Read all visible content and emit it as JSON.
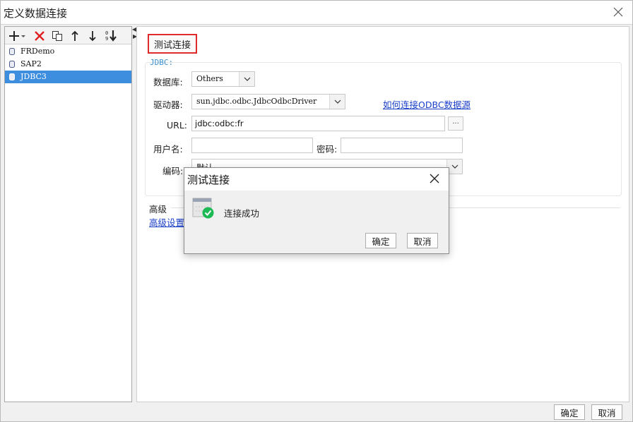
{
  "window": {
    "title": "定义数据连接"
  },
  "toolbar": {
    "add_icon": "plus-dropdown-icon",
    "delete_icon": "red-x-icon",
    "copy_icon": "copy-icon",
    "up_icon": "arrow-up-icon",
    "down_icon": "arrow-down-icon",
    "sort_icon": "sort-descending-icon"
  },
  "datasources": [
    {
      "label": "FRDemo",
      "selected": false
    },
    {
      "label": "SAP2",
      "selected": false
    },
    {
      "label": "JDBC3",
      "selected": true
    }
  ],
  "main": {
    "test_button": "测试连接",
    "group_label": "JDBC:",
    "database_label": "数据库:",
    "database_value": "Others",
    "driver_label": "驱动器:",
    "driver_value": "sun.jdbc.odbc.JdbcOdbcDriver",
    "odbc_link": "如何连接ODBC数据源",
    "url_label": "URL:",
    "url_value": "jdbc:odbc:fr",
    "url_more": "...",
    "username_label": "用户名:",
    "username_value": "",
    "password_label": "密码:",
    "password_value": "",
    "encoding_label": "编码:",
    "encoding_value": "默认",
    "advanced_label": "高级",
    "advanced_link": "高级设置"
  },
  "footer": {
    "ok": "确定",
    "cancel": "取消"
  },
  "dialog": {
    "title": "测试连接",
    "message": "连接成功",
    "ok": "确定",
    "cancel": "取消",
    "icon": "database-success-check-icon"
  },
  "colors": {
    "selection": "#3e8ee0",
    "link": "#1a3fc9",
    "highlight_border": "#e12b2b",
    "success": "#1db954"
  }
}
